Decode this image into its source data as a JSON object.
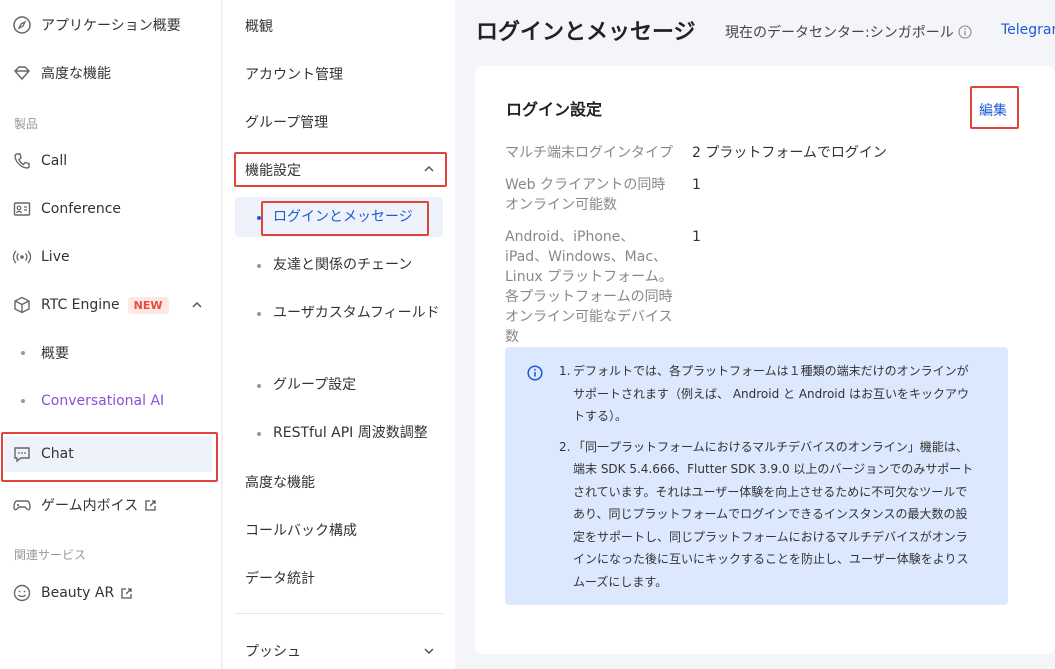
{
  "sidebar": {
    "top_items": [
      {
        "label": "アプリケーション概要",
        "icon": "compass-icon"
      },
      {
        "label": "高度な機能",
        "icon": "diamond-icon"
      }
    ],
    "section_products": "製品",
    "products": [
      {
        "label": "Call",
        "icon": "phone-icon"
      },
      {
        "label": "Conference",
        "icon": "conference-icon"
      },
      {
        "label": "Live",
        "icon": "broadcast-icon"
      },
      {
        "label": "RTC Engine",
        "icon": "cube-icon",
        "badge": "NEW"
      }
    ],
    "rtc_sub": [
      {
        "label": "概要"
      },
      {
        "label": "Conversational AI"
      }
    ],
    "chat": {
      "label": "Chat",
      "icon": "chat-icon"
    },
    "game_voice": {
      "label": "ゲーム内ボイス",
      "icon": "gamepad-icon"
    },
    "section_related": "関連サービス",
    "beauty": {
      "label": "Beauty AR",
      "icon": "smile-icon"
    }
  },
  "midnav": {
    "overview": "概観",
    "account": "アカウント管理",
    "group": "グループ管理",
    "feature_settings": "機能設定",
    "sub_items": [
      {
        "label": "ログインとメッセージ",
        "active": true
      },
      {
        "label": "友達と関係のチェーン"
      },
      {
        "label": "ユーザカスタムフィールド"
      },
      {
        "label": "グループ設定"
      },
      {
        "label": "RESTful API 周波数調整"
      }
    ],
    "advanced": "高度な機能",
    "callback": "コールバック構成",
    "stats": "データ統計",
    "push": "プッシュ"
  },
  "header": {
    "title": "ログインとメッセージ",
    "datacenter": "現在のデータセンター:シンガポール",
    "telegram": "Telegram"
  },
  "card": {
    "title": "ログイン設定",
    "edit": "編集",
    "fields": [
      {
        "label": "マルチ端末ログインタイプ",
        "value": "2 プラットフォームでログイン"
      },
      {
        "label": "Web クライアントの同時オンライン可能数",
        "value": "1"
      },
      {
        "label": "Android、iPhone、iPad、Windows、Mac、Linux プラットフォーム。各プラットフォームの同時オンライン可能なデバイス数",
        "value": "1"
      }
    ],
    "notice": [
      {
        "num": "1.",
        "text": "デフォルトでは、各プラットフォームは１種類の端末だけのオンラインがサポートされます（例えば、 Android と Android はお互いをキックアウトする）。"
      },
      {
        "num": "2.",
        "text": "「同一プラットフォームにおけるマルチデバイスのオンライン」機能は、端末 SDK 5.4.666、Flutter SDK 3.9.0 以上のバージョンでのみサポートされています。それはユーザー体験を向上させるために不可欠なツールであり、同じプラットフォームでログインできるインスタンスの最大数の設定をサポートし、同じプラットフォームにおけるマルチデバイスがオンラインになった後に互いにキックすることを防止し、ユーザー体験をよりスムーズにします。"
      }
    ]
  },
  "colors": {
    "accent": "#1e5bd8",
    "highlight_box": "#e0433a",
    "purple": "#8e4ed8",
    "notice_bg": "#dbe8fd"
  }
}
